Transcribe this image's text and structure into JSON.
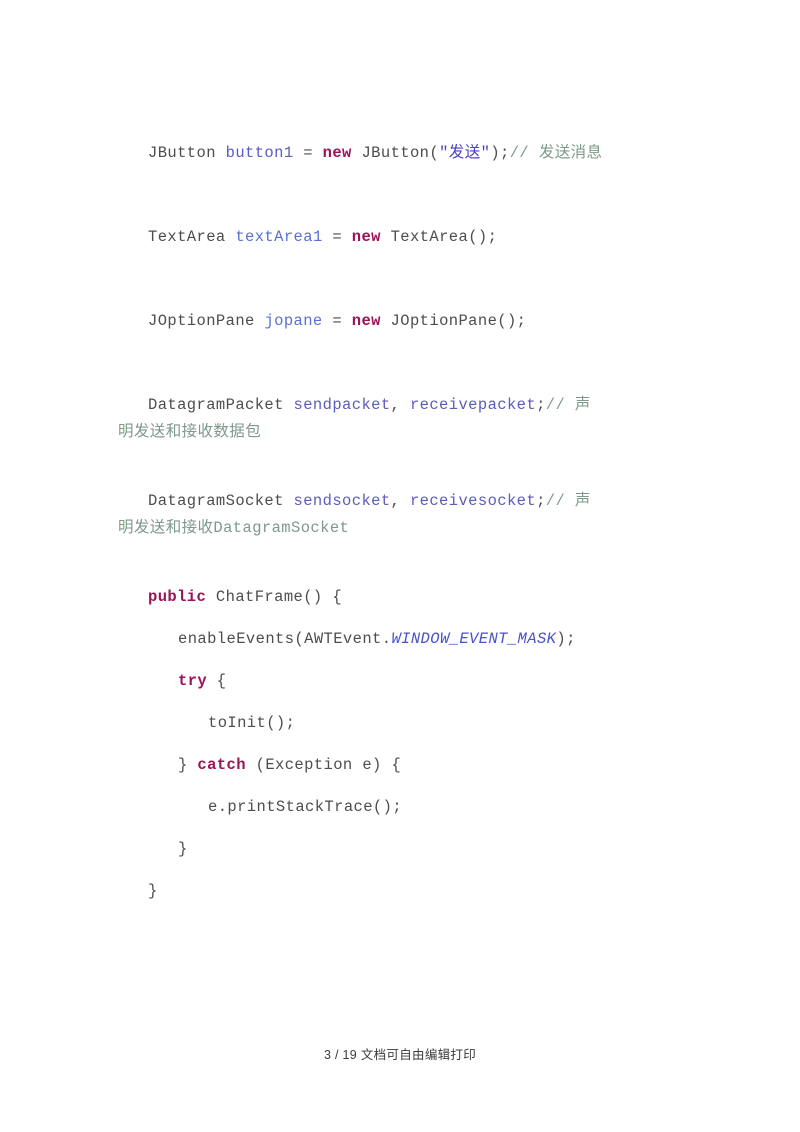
{
  "document": {
    "page_label": "3 / 19 文档可自由编辑打印",
    "footer_page_number": "3",
    "footer_total_pages": "19",
    "footer_note": "文档可自由编辑打印"
  },
  "colors": {
    "plain_text": "#4d4d4d",
    "variable": "#5b5bc0",
    "keyword": "#9c1458",
    "string": "#4a3fc4",
    "comment": "#7d9a8a",
    "static_field": "#4a52cc",
    "page_background": "#ffffff"
  },
  "code": {
    "language": "java",
    "lines": [
      {
        "id": "line-jbutton",
        "indent": 1,
        "tokens": [
          {
            "text": "JButton ",
            "style": "type"
          },
          {
            "text": "button1",
            "style": "var"
          },
          {
            "text": " = ",
            "style": "plain"
          },
          {
            "text": "new",
            "style": "kw"
          },
          {
            "text": " JButton(",
            "style": "plain"
          },
          {
            "text": "\"发送\"",
            "style": "str"
          },
          {
            "text": ");",
            "style": "plain"
          },
          {
            "text": "// 发送消息",
            "style": "comment"
          }
        ]
      },
      {
        "id": "line-textarea",
        "indent": 1,
        "tokens": [
          {
            "text": "TextArea ",
            "style": "type"
          },
          {
            "text": "textArea1",
            "style": "var2"
          },
          {
            "text": " = ",
            "style": "plain"
          },
          {
            "text": "new",
            "style": "kw"
          },
          {
            "text": " TextArea();",
            "style": "plain"
          }
        ]
      },
      {
        "id": "line-joptionpane",
        "indent": 1,
        "tokens": [
          {
            "text": "JOptionPane ",
            "style": "type"
          },
          {
            "text": "jopane",
            "style": "var2"
          },
          {
            "text": " = ",
            "style": "plain"
          },
          {
            "text": "new",
            "style": "kw"
          },
          {
            "text": " JOptionPane();",
            "style": "plain"
          }
        ]
      },
      {
        "id": "line-datagrampacket",
        "indent": 1,
        "tokens": [
          {
            "text": "DatagramPacket ",
            "style": "type"
          },
          {
            "text": "sendpacket",
            "style": "var"
          },
          {
            "text": ", ",
            "style": "plain"
          },
          {
            "text": "receivepacket",
            "style": "var"
          },
          {
            "text": ";",
            "style": "plain"
          },
          {
            "text": "// 声",
            "style": "comment"
          }
        ]
      },
      {
        "id": "line-datagrampacket-wrap",
        "indent": 0,
        "wrap": true,
        "tokens": [
          {
            "text": "明发送和接收数据包",
            "style": "comment"
          }
        ]
      },
      {
        "id": "line-datagramsocket",
        "indent": 1,
        "tokens": [
          {
            "text": "DatagramSocket ",
            "style": "type"
          },
          {
            "text": "sendsocket",
            "style": "var"
          },
          {
            "text": ", ",
            "style": "plain"
          },
          {
            "text": "receivesocket",
            "style": "var"
          },
          {
            "text": ";",
            "style": "plain"
          },
          {
            "text": "// 声",
            "style": "comment"
          }
        ]
      },
      {
        "id": "line-datagramsocket-wrap",
        "indent": 0,
        "wrap": true,
        "tokens": [
          {
            "text": "明发送和接收DatagramSocket",
            "style": "comment"
          }
        ]
      },
      {
        "id": "line-constructor",
        "indent": 1,
        "tokens": [
          {
            "text": "public",
            "style": "kw"
          },
          {
            "text": " ChatFrame() {",
            "style": "plain"
          }
        ]
      },
      {
        "id": "line-enableevents",
        "indent": 2,
        "tokens": [
          {
            "text": "enableEvents(AWTEvent.",
            "style": "plain"
          },
          {
            "text": "WINDOW_EVENT_MASK",
            "style": "static"
          },
          {
            "text": ");",
            "style": "plain"
          }
        ]
      },
      {
        "id": "line-try",
        "indent": 2,
        "tokens": [
          {
            "text": "try",
            "style": "kw"
          },
          {
            "text": " {",
            "style": "plain"
          }
        ]
      },
      {
        "id": "line-toinit",
        "indent": 3,
        "tokens": [
          {
            "text": "toInit();",
            "style": "plain"
          }
        ]
      },
      {
        "id": "line-catch",
        "indent": 2,
        "tokens": [
          {
            "text": "} ",
            "style": "plain"
          },
          {
            "text": "catch",
            "style": "kw"
          },
          {
            "text": " (Exception e) {",
            "style": "plain"
          }
        ]
      },
      {
        "id": "line-printstacktrace",
        "indent": 3,
        "tokens": [
          {
            "text": "e.printStackTrace();",
            "style": "plain"
          }
        ]
      },
      {
        "id": "line-close-catch",
        "indent": 2,
        "tokens": [
          {
            "text": "}",
            "style": "plain"
          }
        ]
      },
      {
        "id": "line-close-constructor",
        "indent": 1,
        "tokens": [
          {
            "text": "}",
            "style": "plain"
          }
        ]
      }
    ]
  }
}
